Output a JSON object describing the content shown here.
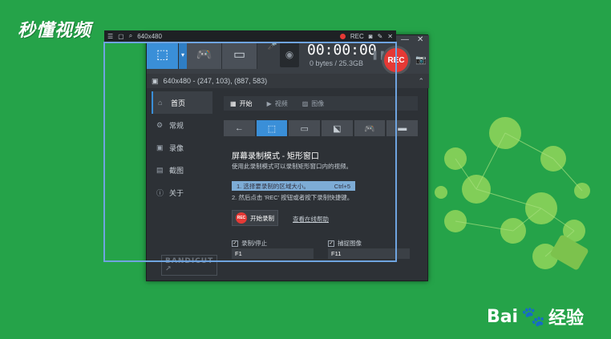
{
  "watermark": "秒懂视频",
  "baidu": {
    "brand": "Bai",
    "paw": "🐾",
    "suffix": "经验"
  },
  "toolbar": {
    "size_label": "640x480",
    "rec_label": "REC"
  },
  "recorder": {
    "timer": "00:00:00",
    "size": "0 bytes / 25.3GB",
    "rec_button": "REC",
    "info": "640x480 - (247, 103), (887, 583)"
  },
  "sidebar": {
    "items": [
      {
        "label": "首页",
        "icon": "home-icon"
      },
      {
        "label": "常规",
        "icon": "gear-icon"
      },
      {
        "label": "录像",
        "icon": "video-icon"
      },
      {
        "label": "截图",
        "icon": "image-icon"
      },
      {
        "label": "关于",
        "icon": "info-icon"
      }
    ],
    "logo": "BANDICUT ↗"
  },
  "main": {
    "tabs": [
      {
        "label": "开始"
      },
      {
        "label": "视频"
      },
      {
        "label": "图像"
      }
    ],
    "title": "屏幕录制模式 - 矩形窗口",
    "desc": "使用此录制模式可以录制矩形窗口内的视频。",
    "step1": "1. 选择要录制的区域大小。",
    "step1_hotkey": "Ctrl+5",
    "step2": "2. 然后点击 'REC' 按钮或者按下录制快捷键。",
    "start_label": "开始录制",
    "help_link": "查看在线帮助",
    "hotkey1_label": "录制/停止",
    "hotkey1_value": "F1",
    "hotkey2_label": "捕捉图像",
    "hotkey2_value": "F11"
  }
}
